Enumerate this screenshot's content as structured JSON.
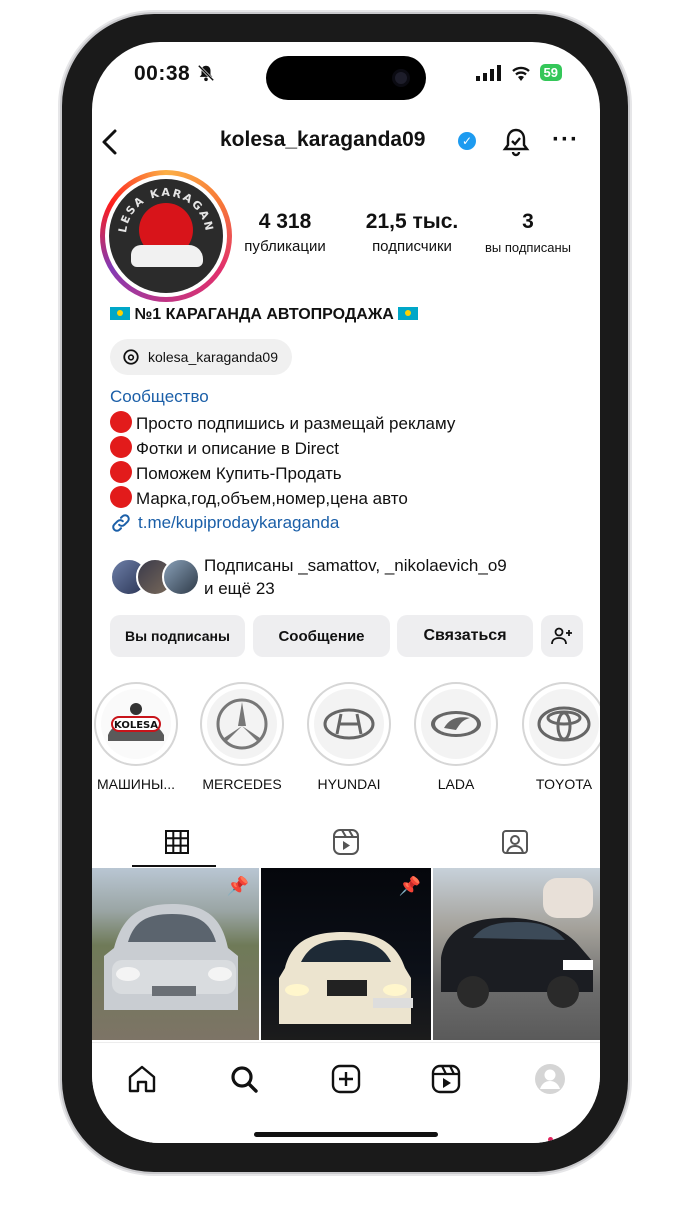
{
  "status": {
    "time": "00:38",
    "battery": "59"
  },
  "header": {
    "username": "kolesa_karaganda09"
  },
  "stats": [
    {
      "value": "4 318",
      "label": "публикации"
    },
    {
      "value": "21,5 тыс.",
      "label": "подписчики"
    },
    {
      "value": "3",
      "label": "вы подписаны"
    }
  ],
  "avatar": {
    "text": "KOLESA KARAGANDA"
  },
  "bio": {
    "title": "№1 КАРАГАНДА АВТОПРОДАЖА",
    "threads_handle": "kolesa_karaganda09",
    "category": "Сообщество",
    "lines": [
      "Просто подпишись и размещай рекламу",
      "Фотки и описание в Direct",
      "Поможем Купить-Продать",
      "Марка,год,объем,номер,цена авто"
    ],
    "link": "t.me/kupiprodaykaraganda"
  },
  "mutuals": {
    "line1": "Подписаны _samattov, _nikolaevich_o9",
    "line2": "и ещё 23"
  },
  "actions": {
    "following": "Вы подписаны",
    "message": "Сообщение",
    "contact": "Связаться"
  },
  "highlights": [
    {
      "label": "МАШИНЫ...",
      "icon": "kolesa-logo-icon"
    },
    {
      "label": "MERCEDES",
      "icon": "mercedes-logo-icon"
    },
    {
      "label": "HYUNDAI",
      "icon": "hyundai-logo-icon"
    },
    {
      "label": "LADA",
      "icon": "lada-logo-icon"
    },
    {
      "label": "TOYOTA",
      "icon": "toyota-logo-icon"
    }
  ],
  "colors": {
    "link": "#1b5fa8",
    "verified": "#1d9bf0",
    "notification_dot": "#e0245e",
    "bullet": "#e21b1b"
  }
}
